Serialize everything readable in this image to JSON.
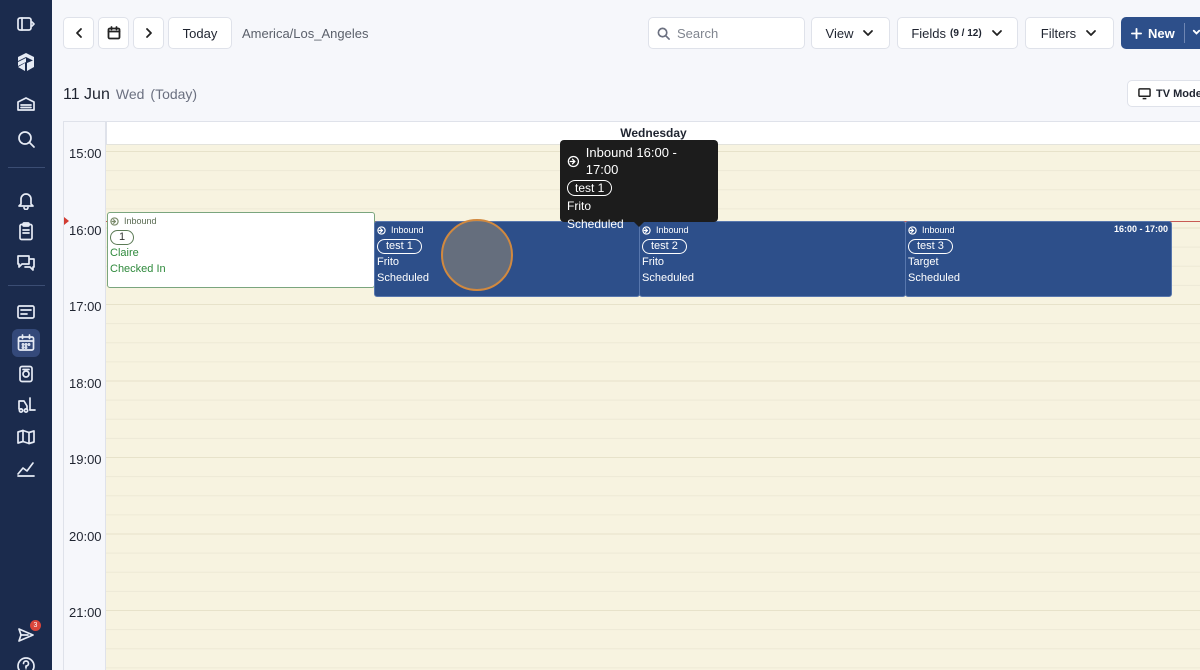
{
  "sidebar": {
    "items": [
      {
        "icon": "panel-toggle-icon"
      },
      {
        "icon": "logo-cube-icon"
      },
      {
        "icon": "warehouse-icon"
      },
      {
        "icon": "search-icon"
      },
      {
        "icon": "bell-icon"
      },
      {
        "icon": "clipboard-icon"
      },
      {
        "icon": "chat-icon"
      },
      {
        "icon": "inbox-list-icon"
      },
      {
        "icon": "calendar-icon",
        "active": true
      },
      {
        "icon": "inventory-icon"
      },
      {
        "icon": "forklift-icon"
      },
      {
        "icon": "map-icon"
      },
      {
        "icon": "chart-icon"
      },
      {
        "icon": "send-icon"
      },
      {
        "icon": "help-icon"
      }
    ],
    "notification_count": "3"
  },
  "toolbar": {
    "today_label": "Today",
    "timezone": "America/Los_Angeles",
    "search_placeholder": "Search",
    "view_label": "View",
    "fields_label": "Fields",
    "fields_count": "(9 / 12)",
    "filters_label": "Filters",
    "new_label": "New"
  },
  "date_header": {
    "date": "11 Jun",
    "weekday": "Wed",
    "today_tag": "(Today)",
    "tv_mode_label": "TV Mode"
  },
  "calendar": {
    "day_label": "Wednesday",
    "hours": [
      "15:00",
      "16:00",
      "17:00",
      "18:00",
      "19:00",
      "20:00",
      "21:00"
    ],
    "events": [
      {
        "type": "Inbound",
        "ref": "1",
        "carrier": "Claire",
        "status": "Checked In",
        "style": "white"
      },
      {
        "type": "Inbound",
        "ref": "test 1",
        "carrier": "Frito",
        "status": "Scheduled",
        "style": "blue"
      },
      {
        "type": "Inbound",
        "ref": "test 2",
        "carrier": "Frito",
        "status": "Scheduled",
        "style": "blue"
      },
      {
        "type": "Inbound",
        "ref": "test 3",
        "carrier": "Target",
        "status": "Scheduled",
        "style": "blue",
        "time": "16:00 - 17:00"
      }
    ]
  },
  "tooltip": {
    "title": "Inbound 16:00 - 17:00",
    "ref": "test 1",
    "carrier": "Frito",
    "status": "Scheduled"
  },
  "colors": {
    "sidebar": "#1b2b4d",
    "primary": "#2d4f8a",
    "grid": "#f7f3e0",
    "now_line": "#c85a54"
  }
}
